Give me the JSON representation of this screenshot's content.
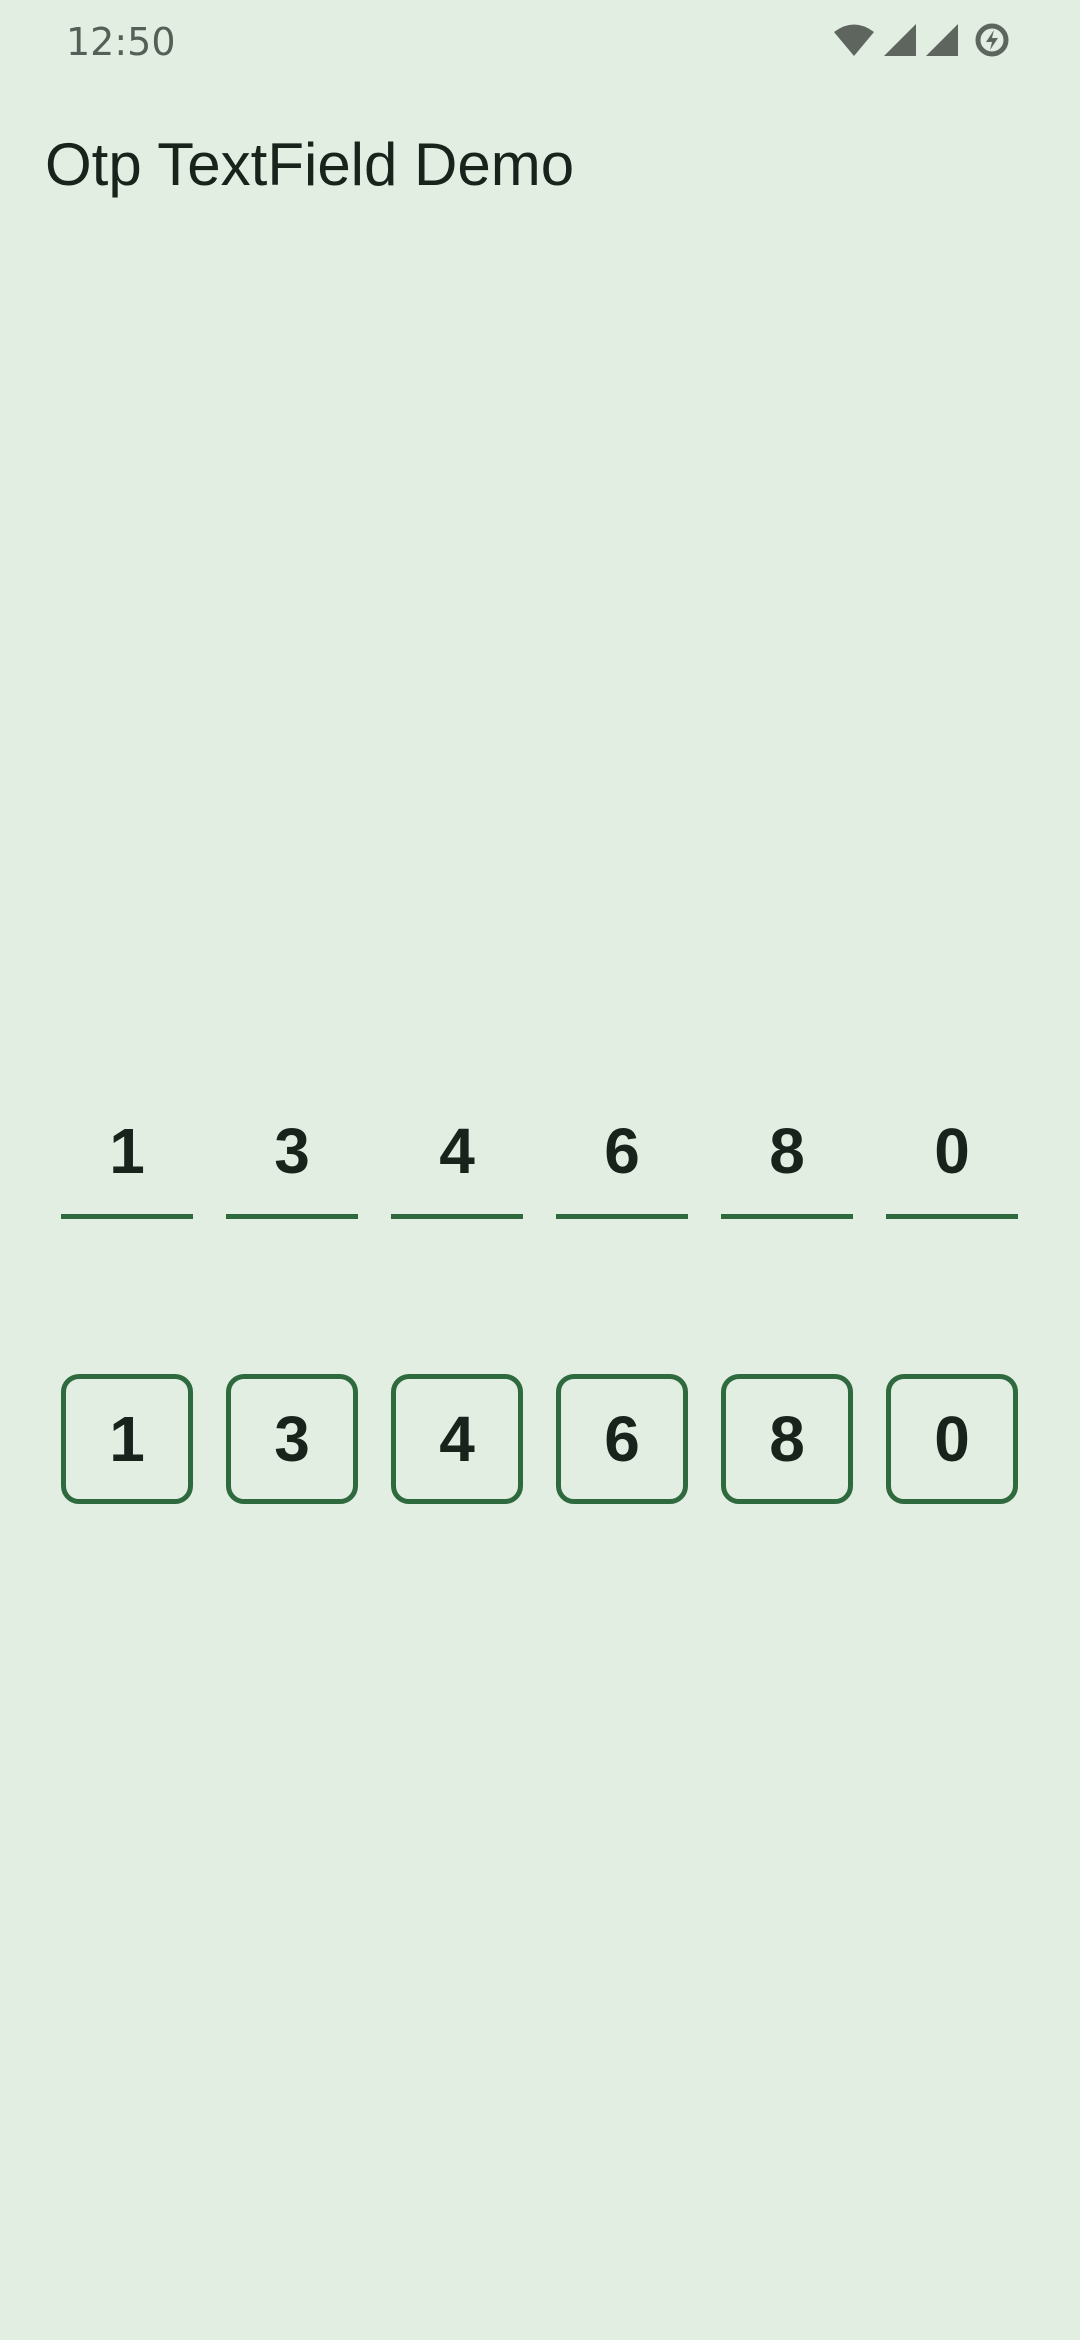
{
  "status_bar": {
    "time": "12:50",
    "icons": [
      "wifi-icon",
      "cell-signal-icon",
      "cell-signal-icon",
      "battery-saver-icon"
    ]
  },
  "app_bar": {
    "title": "Otp TextField Demo"
  },
  "otp_underline": {
    "digits": [
      "1",
      "3",
      "4",
      "6",
      "8",
      "0"
    ]
  },
  "otp_boxed": {
    "digits": [
      "1",
      "3",
      "4",
      "6",
      "8",
      "0"
    ]
  },
  "colors": {
    "background": "#e2eee2",
    "accent": "#2f6a3f",
    "text": "#17231b"
  }
}
